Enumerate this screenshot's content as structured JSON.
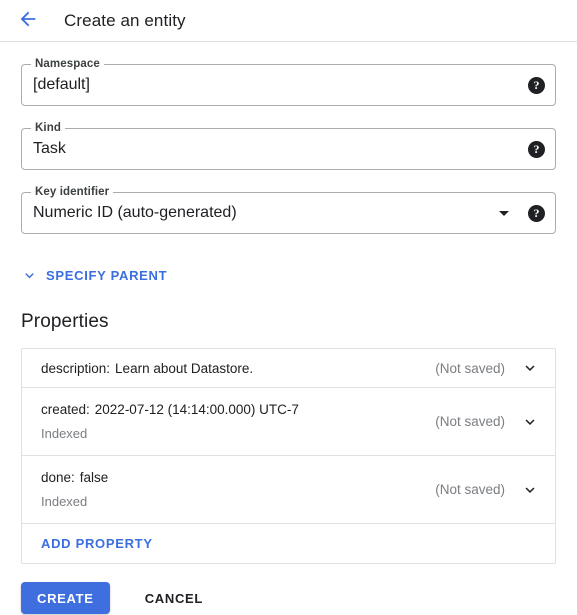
{
  "header": {
    "back_icon": "arrow-left-icon",
    "title": "Create an entity"
  },
  "form": {
    "fields": [
      {
        "label": "Namespace",
        "value": "[default]",
        "type": "text",
        "help_icon": "help-icon"
      },
      {
        "label": "Kind",
        "value": "Task",
        "type": "text",
        "help_icon": "help-icon"
      },
      {
        "label": "Key identifier",
        "value": "Numeric ID (auto-generated)",
        "type": "select",
        "help_icon": "help-icon"
      }
    ],
    "specify_parent": {
      "label": "SPECIFY PARENT",
      "icon": "chevron-down-icon"
    }
  },
  "properties": {
    "title": "Properties",
    "rows": [
      {
        "key": "description:",
        "value": "Learn about Datastore.",
        "indexed": "",
        "status": "(Not saved)",
        "expand_icon": "chevron-down-icon"
      },
      {
        "key": "created:",
        "value": "2022-07-12 (14:14:00.000) UTC-7",
        "indexed": "Indexed",
        "status": "(Not saved)",
        "expand_icon": "chevron-down-icon"
      },
      {
        "key": "done:",
        "value": "false",
        "indexed": "Indexed",
        "status": "(Not saved)",
        "expand_icon": "chevron-down-icon"
      }
    ],
    "add_property_label": "ADD PROPERTY"
  },
  "footer": {
    "create_label": "CREATE",
    "cancel_label": "CANCEL"
  },
  "colors": {
    "accent_blue": "#3b6fdf",
    "primary_button": "#3f6fdf",
    "text_primary": "#202124",
    "text_secondary": "#7a7d81",
    "border": "#e0e0e0"
  }
}
